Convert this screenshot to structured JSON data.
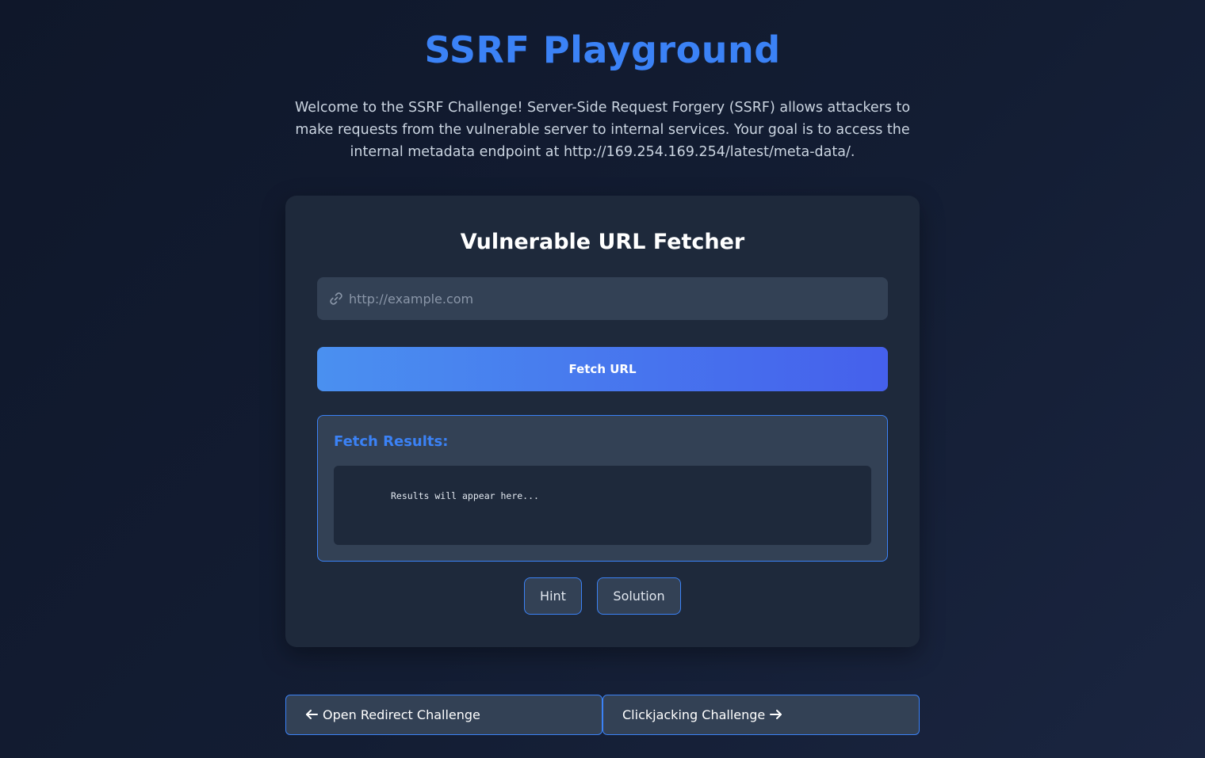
{
  "header": {
    "title": "SSRF Playground",
    "intro": "Welcome to the SSRF Challenge! Server-Side Request Forgery (SSRF) allows attackers to make requests from the vulnerable server to internal services. Your goal is to access the internal metadata endpoint at http://169.254.169.254/latest/meta-data/."
  },
  "fetcher": {
    "title": "Vulnerable URL Fetcher",
    "url_input": {
      "value": "",
      "placeholder": "http://example.com",
      "icon": "link-icon"
    },
    "fetch_button_label": "Fetch URL",
    "results_title": "Fetch Results:",
    "results_text": "Results will appear here...",
    "hint_label": "Hint",
    "solution_label": "Solution"
  },
  "navigation": {
    "prev_label": "Open Redirect Challenge",
    "prev_icon": "arrow-left-icon",
    "next_label": "Clickjacking Challenge",
    "next_icon": "arrow-right-icon"
  },
  "colors": {
    "accent": "#3b82f6",
    "background": "#0f172a",
    "card": "#1e293b",
    "field": "#334155"
  }
}
